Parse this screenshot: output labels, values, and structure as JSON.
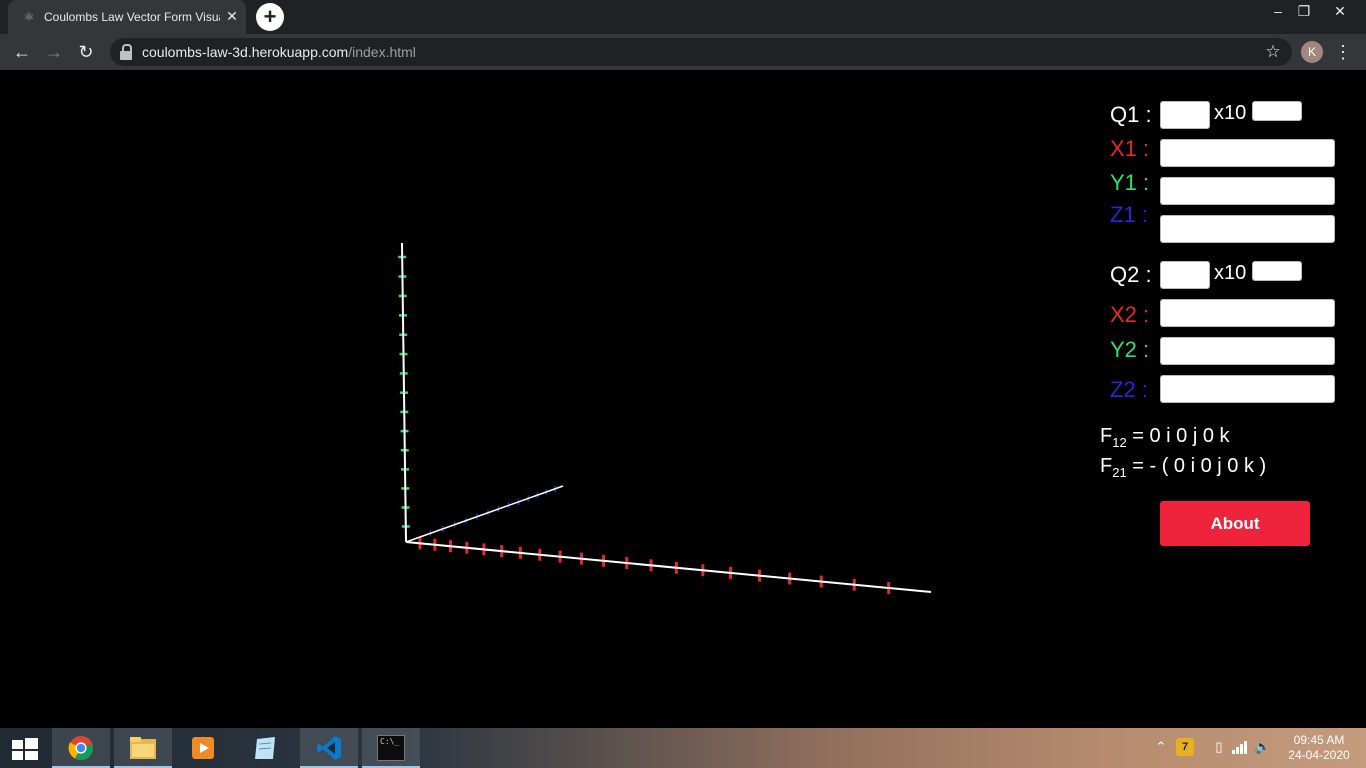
{
  "browser": {
    "tab_title": "Coulombs Law Vector Form Visua",
    "tab_close": "✕",
    "new_tab": "+",
    "url_domain": "coulombs-law-3d.herokuapp.com",
    "url_path": "/index.html",
    "profile_initial": "K",
    "window_controls": {
      "minimize": "–",
      "restore": "❐",
      "close": "✕"
    }
  },
  "form": {
    "q1_label": "Q1 :",
    "x1_label": "X1 :",
    "y1_label": "Y1 :",
    "z1_label": "Z1 :",
    "q2_label": "Q2 :",
    "x2_label": "X2 :",
    "y2_label": "Y2 :",
    "z2_label": "Z2 :",
    "multiplier_label": "x10",
    "values": {
      "q1": "",
      "q1_exp": "",
      "x1": "",
      "y1": "",
      "z1": "",
      "q2": "",
      "q2_exp": "",
      "x2": "",
      "y2": "",
      "z2": ""
    }
  },
  "results": {
    "f12_symbol": "F",
    "f12_sub": "12",
    "f12_value": " = 0 i 0 j 0 k",
    "f21_symbol": "F",
    "f21_sub": "21",
    "f21_value": " = - ( 0 i 0 j 0 k )"
  },
  "about_button": "About",
  "scene": {
    "axis_color": "#ffffff",
    "x_tick_color": "#e8262d",
    "y_tick_color": "#2ee06d",
    "z_tick_color": "#2727d8"
  },
  "taskbar": {
    "apps": [
      "windows-start",
      "chrome",
      "file-explorer",
      "media-player",
      "notepad",
      "vscode",
      "command-prompt"
    ],
    "cmd_glyph": "C:\\_",
    "time": "09:45 AM",
    "date": "24-04-2020"
  }
}
